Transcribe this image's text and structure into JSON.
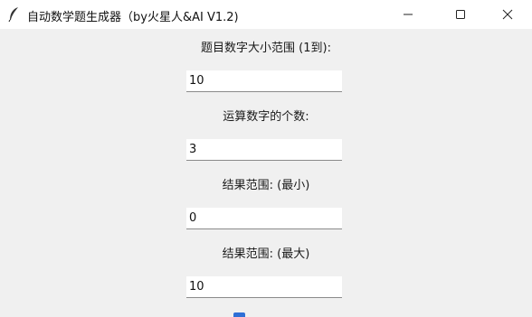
{
  "window": {
    "title": "自动数学题生成器（by火星人&AI V1.2)",
    "icon": "feather-icon",
    "controls": {
      "minimize_icon": "minimize-icon",
      "maximize_icon": "maximize-icon",
      "close_icon": "close-icon"
    }
  },
  "form": {
    "number_range": {
      "label": "题目数字大小范围 (1到):",
      "value": "10"
    },
    "operand_count": {
      "label": "运算数字的个数:",
      "value": "3"
    },
    "result_min": {
      "label": "结果范围: (最小)",
      "value": "0"
    },
    "result_max": {
      "label": "结果范围: (最大)",
      "value": "10"
    }
  },
  "colors": {
    "titlebar": "#ffffff",
    "background": "#f0f0f0",
    "input_bg": "#ffffff",
    "checkbox_accent": "#2f6fd6"
  }
}
